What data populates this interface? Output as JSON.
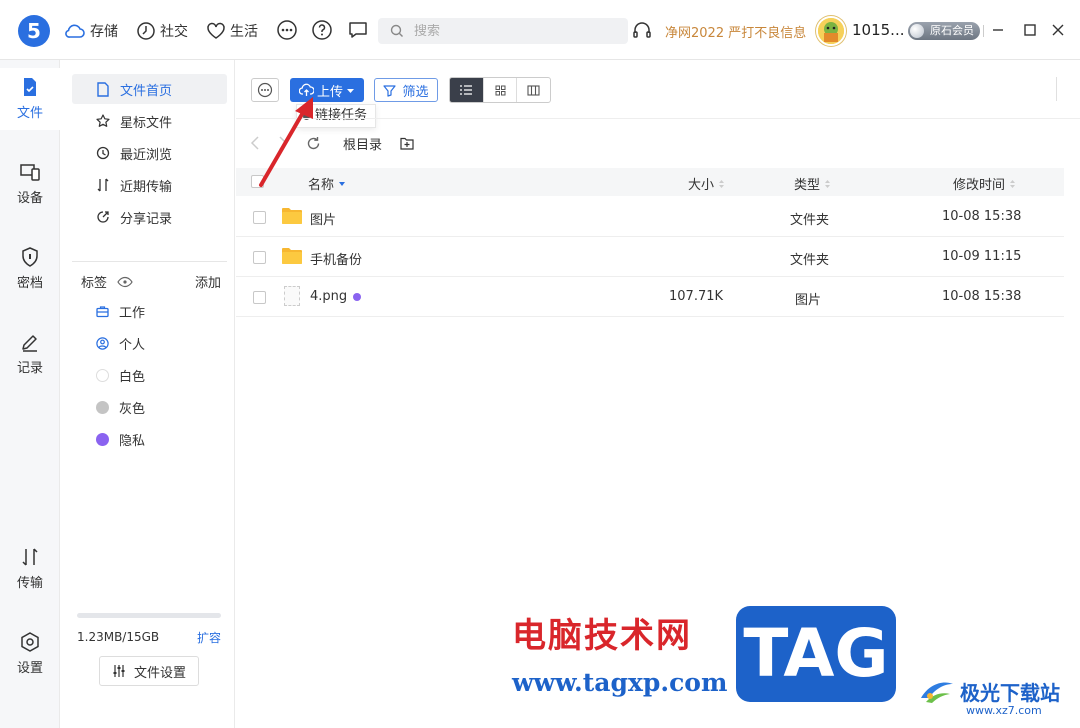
{
  "topbar": {
    "logo": "5",
    "nav": [
      {
        "label": "存储",
        "icon": "cloud-icon"
      },
      {
        "label": "社交",
        "icon": "compass-icon"
      },
      {
        "label": "生活",
        "icon": "heart-icon"
      }
    ],
    "search_placeholder": "搜索",
    "promo": "净网2022 严打不良信息",
    "username": "1015...",
    "vip_label": "原石会员"
  },
  "rail": {
    "items": [
      {
        "label": "文件",
        "icon": "file-icon"
      },
      {
        "label": "设备",
        "icon": "device-icon"
      },
      {
        "label": "密档",
        "icon": "shield-icon"
      },
      {
        "label": "记录",
        "icon": "pen-icon"
      },
      {
        "label": "传输",
        "icon": "transfer-icon"
      },
      {
        "label": "设置",
        "icon": "settings-icon"
      }
    ]
  },
  "side": {
    "items": [
      {
        "label": "文件首页",
        "icon": "document-icon"
      },
      {
        "label": "星标文件",
        "icon": "star-icon"
      },
      {
        "label": "最近浏览",
        "icon": "history-icon"
      },
      {
        "label": "近期传输",
        "icon": "transfer-icon"
      },
      {
        "label": "分享记录",
        "icon": "share-icon"
      }
    ],
    "tags_title": "标签",
    "tags_add": "添加",
    "tags": [
      {
        "label": "工作",
        "color": "#2a6fe0"
      },
      {
        "label": "个人",
        "color": "#2a6fe0"
      },
      {
        "label": "白色",
        "color": "#ffffff"
      },
      {
        "label": "灰色",
        "color": "#c4c4c4"
      },
      {
        "label": "隐私",
        "color": "#8a63f0"
      }
    ],
    "storage_text": "1.23MB/15GB",
    "storage_fraction": 0.0001,
    "expand_label": "扩容",
    "file_settings_label": "文件设置"
  },
  "toolbar": {
    "upload_label": "上传",
    "filter_label": "筛选",
    "dropdown_item": "链接任务"
  },
  "path": {
    "root_label": "根目录"
  },
  "table": {
    "columns": {
      "name": "名称",
      "size": "大小",
      "type": "类型",
      "modified": "修改时间"
    },
    "rows": [
      {
        "name": "图片",
        "size": "",
        "type": "文件夹",
        "modified": "10-08 15:38",
        "kind": "folder"
      },
      {
        "name": "手机备份",
        "size": "",
        "type": "文件夹",
        "modified": "10-09 11:15",
        "kind": "folder"
      },
      {
        "name": "4.png",
        "size": "107.71K",
        "type": "图片",
        "modified": "10-08 15:38",
        "kind": "image"
      }
    ]
  },
  "watermark": {
    "title": "电脑技术网",
    "url": "www.tagxp.com",
    "tag": "TAG",
    "site_name": "极光下载站",
    "site_url": "www.xz7.com"
  },
  "colors": {
    "accent": "#2a6fe0",
    "promo": "#c8873b",
    "private_tag": "#8a63f0",
    "annotation_arrow": "#d9262b"
  }
}
